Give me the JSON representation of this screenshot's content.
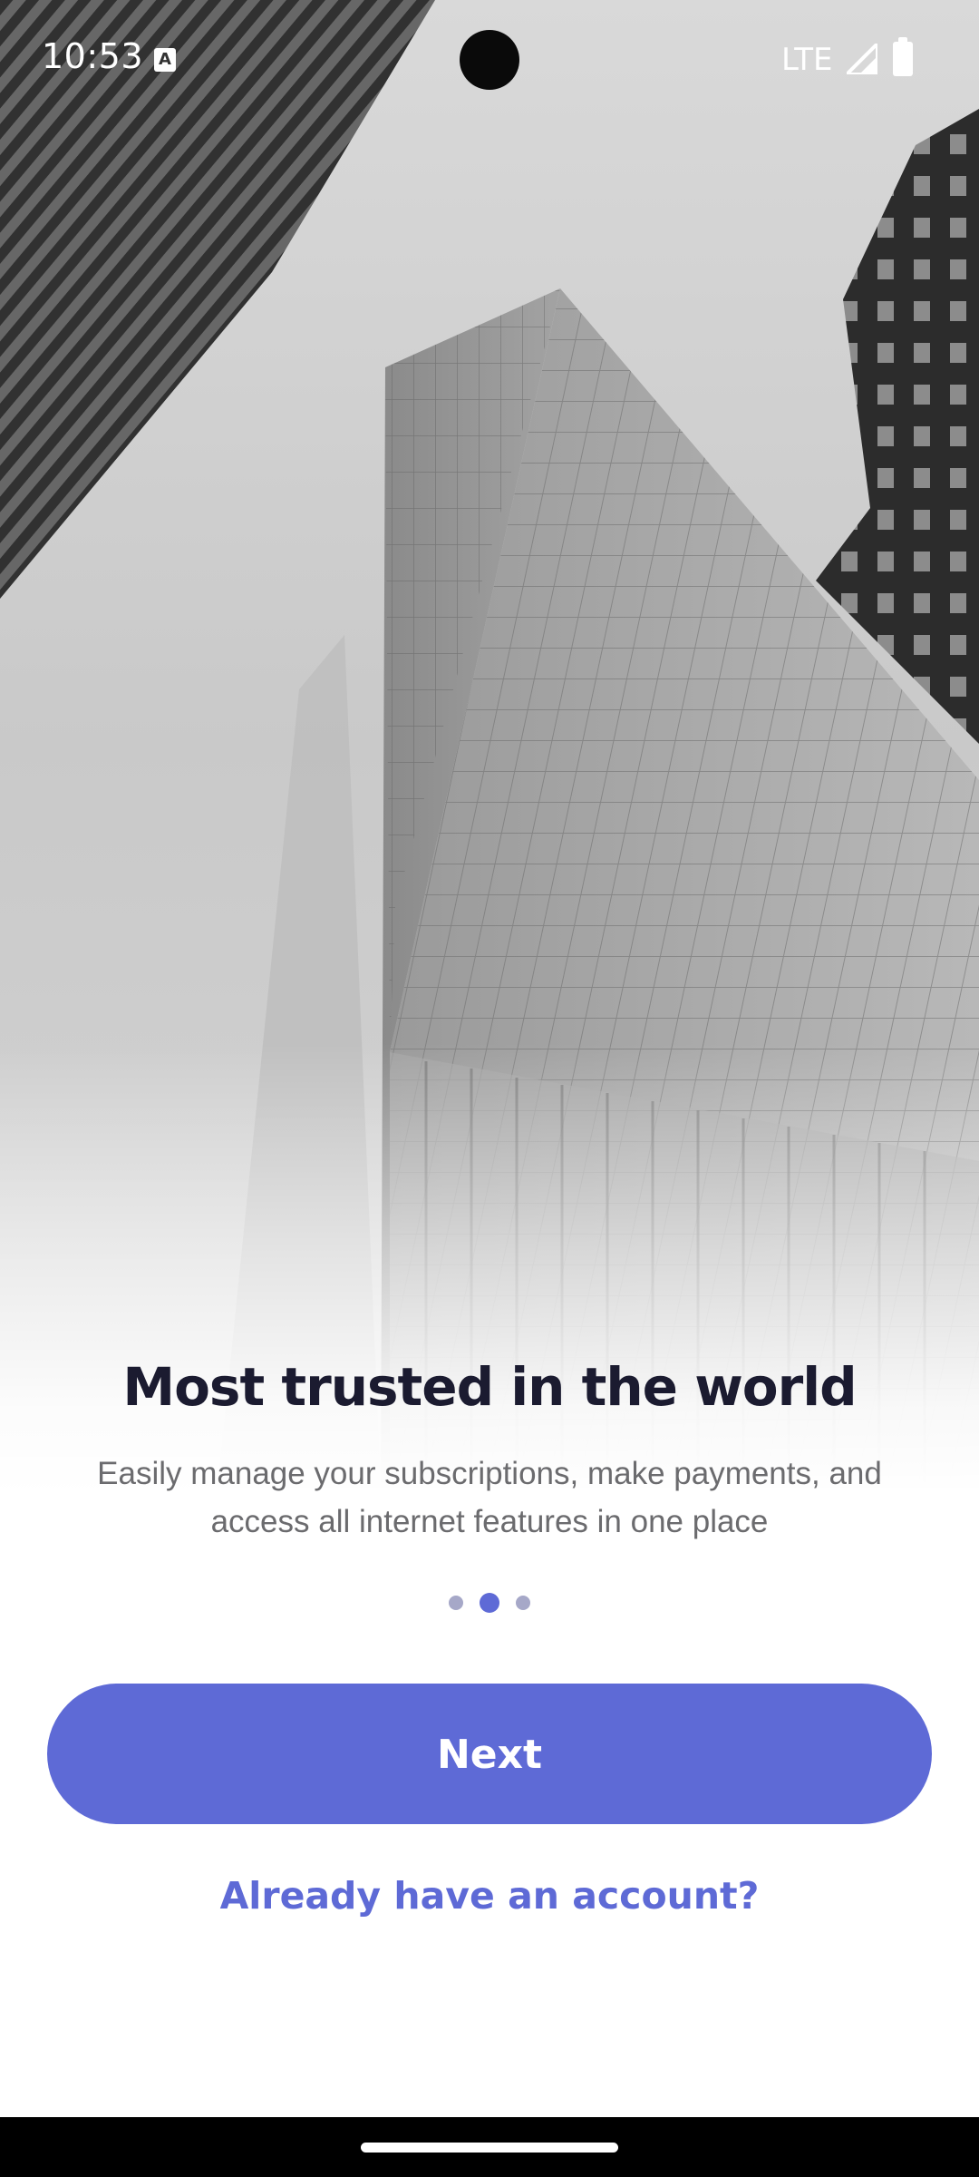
{
  "status_bar": {
    "time": "10:53",
    "notification_icon": "a-notification-icon",
    "network": "LTE",
    "signal_icon": "cell-signal-icon",
    "battery_icon": "battery-full-icon"
  },
  "hero": {
    "image": "skyscraper-grayscale-photo"
  },
  "onboarding": {
    "title": "Most trusted in the world",
    "subtitle": "Easily manage your subscriptions, make payments, and access all internet features in one place",
    "page_count": 3,
    "current_page": 2
  },
  "actions": {
    "next_label": "Next",
    "account_link_label": "Already have an account?"
  },
  "colors": {
    "accent": "#5e6ad6",
    "title": "#1b1b30",
    "subtitle": "#6b6b6e",
    "dot_inactive": "#a6a8c8"
  }
}
